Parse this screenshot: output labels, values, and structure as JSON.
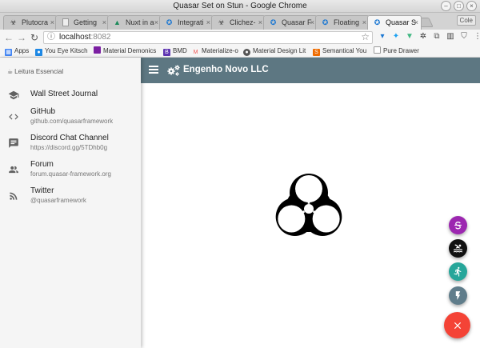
{
  "window": {
    "title": "Quasar Set on Stun - Google Chrome",
    "controls": [
      "–",
      "□",
      "×"
    ]
  },
  "tabs": [
    {
      "label": "Plutocra",
      "icon": "biohazard-icon"
    },
    {
      "label": "Getting",
      "icon": "document-icon"
    },
    {
      "label": "Nuxt in a",
      "icon": "nuxt-icon"
    },
    {
      "label": "Integrati",
      "icon": "quasar-icon"
    },
    {
      "label": "Clichez-",
      "icon": "biohazard-icon"
    },
    {
      "label": "Quasar F",
      "icon": "quasar-icon"
    },
    {
      "label": "Floating",
      "icon": "quasar-icon"
    },
    {
      "label": "Quasar S",
      "icon": "quasar-icon"
    }
  ],
  "active_tab_index": 7,
  "profile_label": "Cole",
  "address_bar": {
    "url_host": "localhost",
    "url_port": ":8082"
  },
  "bookmarks": [
    {
      "label": "Apps",
      "color": "#4285f4"
    },
    {
      "label": "You Eye Kitsch",
      "color": "#1e88e5"
    },
    {
      "label": "Material Demonics",
      "color": "#7b1fa2"
    },
    {
      "label": "BMD",
      "color": "#5e35b1"
    },
    {
      "label": "Materialize-o",
      "color": "#ef5350"
    },
    {
      "label": "Material Design Lit",
      "color": "#555555"
    },
    {
      "label": "Semantical You",
      "color": "#ef6c00"
    },
    {
      "label": "Pure Drawer",
      "color": "#9e9e9e"
    }
  ],
  "drawer": {
    "header": "Leitura Essencial",
    "items": [
      {
        "label": "Wall Street Journal",
        "sublabel": "",
        "icon": "school-icon"
      },
      {
        "label": "GitHub",
        "sublabel": "github.com/quasarframework",
        "icon": "code-icon"
      },
      {
        "label": "Discord Chat Channel",
        "sublabel": "https://discord.gg/5TDhb0g",
        "icon": "chat-icon"
      },
      {
        "label": "Forum",
        "sublabel": "forum.quasar-framework.org",
        "icon": "forum-icon"
      },
      {
        "label": "Twitter",
        "sublabel": "@quasarframework",
        "icon": "rss-icon"
      }
    ]
  },
  "header": {
    "title": "Engenho Novo LLC"
  },
  "fabs": [
    {
      "name": "fab-purple",
      "color": "#9c27b0",
      "icon": "currency-icon"
    },
    {
      "name": "fab-black",
      "color": "#111111",
      "icon": "pool-icon"
    },
    {
      "name": "fab-teal",
      "color": "#26a69a",
      "icon": "run-icon"
    },
    {
      "name": "fab-grey",
      "color": "#607d8b",
      "icon": "bolt-icon"
    }
  ],
  "fab_main": {
    "color": "#f44336",
    "icon": "close-icon"
  },
  "colors": {
    "header_bg": "#5d7782",
    "drawer_bg": "#f5f5f5"
  }
}
